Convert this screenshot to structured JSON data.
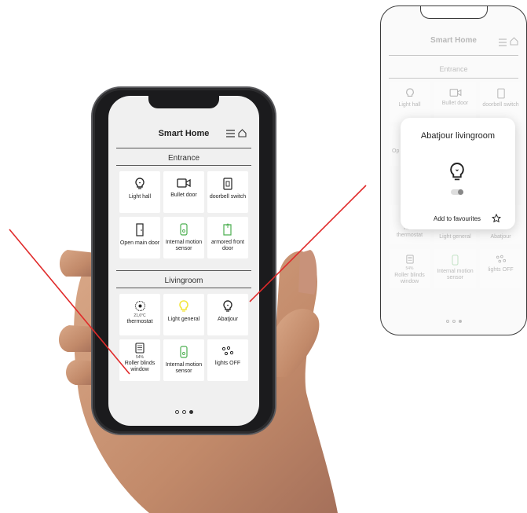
{
  "header": {
    "title": "Smart Home"
  },
  "sections": {
    "entrance": {
      "title": "Entrance",
      "tiles": [
        {
          "label": "Light hall",
          "icon": "bulb-icon"
        },
        {
          "label": "Bullet door",
          "icon": "camera-icon"
        },
        {
          "label": "doorbell switch",
          "icon": "switch-icon"
        },
        {
          "label": "Open main door",
          "icon": "door-icon"
        },
        {
          "label": "Internal motion sensor",
          "icon": "motion-sensor-icon"
        },
        {
          "label": "armored front door",
          "icon": "door-open-icon"
        }
      ]
    },
    "livingroom": {
      "title": "Livingroom",
      "tiles": [
        {
          "label": "thermostat",
          "value": "21,6°C",
          "icon": "thermostat-icon"
        },
        {
          "label": "Light general",
          "icon": "bulb-on-icon"
        },
        {
          "label": "Abatjour",
          "icon": "bulb-icon"
        },
        {
          "label": "Roller blinds window",
          "value": "54%",
          "icon": "blinds-icon"
        },
        {
          "label": "Internal motion sensor",
          "icon": "motion-sensor-icon"
        },
        {
          "label": "lights OFF",
          "icon": "lights-group-icon"
        }
      ]
    }
  },
  "popup": {
    "title": "Abatjour livingroom",
    "favourite_label": "Add to favourites",
    "toggle_state": "off"
  },
  "background_tiles": {
    "row1": [
      "Light hall",
      "Bullet door",
      "doorbell switch"
    ],
    "row2_partial": "Op",
    "row3": [
      "thermostat",
      "Light general",
      "Abatjour"
    ],
    "row3_value": "21,6°C",
    "row4": [
      "Roller blinds window",
      "Internal motion sensor",
      "lights OFF"
    ],
    "row4_value": "54%"
  },
  "pager": {
    "pages": 3,
    "active": 3
  },
  "colors": {
    "accent_yellow": "#f3e63a",
    "sensor_green": "#4caf50",
    "pointer_red": "#e02a2a",
    "screen_bg": "#f0f0f0"
  }
}
